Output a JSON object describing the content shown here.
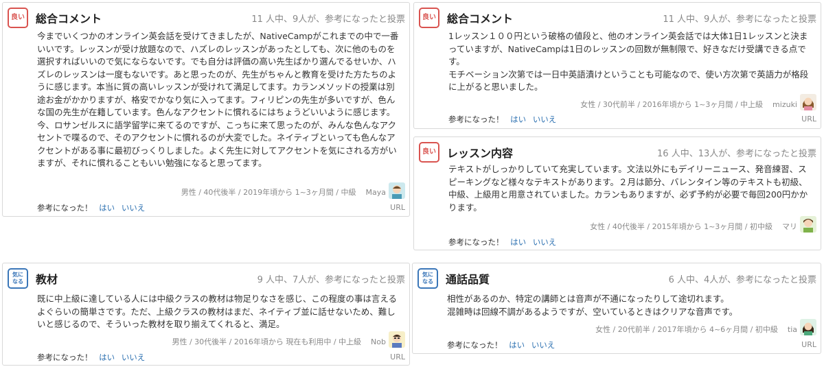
{
  "reviews": [
    {
      "badge_line1": "良い",
      "badge_line2": "",
      "title": "総合コメント",
      "votes": "11 人中、9人が、参考になったと投票",
      "body": [
        "今までいくつかのオンライン英会話を受けてきましたが、NativeCampがこれまでの中で一番いいです。レッスンが受け放題なので、ハズレのレッスンがあったとしても、次に他のものを選択すればいいので気にならないです。でも自分は評価の高い先生ばかり選んでるせいか、ハズレのレッスンは一度もないです。あと思ったのが、先生がちゃんと教育を受けた方たちのように感じます。本当に質の高いレッスンが受けれて満足してます。カランメソッドの授業は別途お金がかかりますが、格安でかなり気に入ってます。フィリピンの先生が多いですが、色んな国の先生が在籍しています。色んなアクセントに慣れるにはちょうどいいように感じます。今、ロサンゼルスに語学留学に来てるのですが、こっちに来て思ったのが、みんな色んなアクセントで喋るので、そのアクセントに慣れるのが大変でした。ネイティブといっても色んなアクセントがある事に最初びっくりしました。よく先生に対してアクセントを気にされる方がいますが、それに慣れることもいい勉強になると思ってます。"
      ],
      "meta": "男性 / 40代後半 / 2019年頃から 1~3ヶ月間 / 中級",
      "user": "Maya",
      "helpful_label": "参考になった！",
      "yes": "はい",
      "no": "いいえ",
      "url": "URL"
    },
    {
      "badge_line1": "良い",
      "badge_line2": "",
      "title": "総合コメント",
      "votes": "11 人中、9人が、参考になったと投票",
      "body": [
        "1レッスン１００円という破格の値段と、他のオンライン英会話では大体1日1レッスンと決まっていますが、NativeCampは1日のレッスンの回数が無制限で、好きなだけ受講できる点です。",
        "モチベーション次第では一日中英語漬けということも可能なので、使い方次第で英語力が格段に上がると思いました。"
      ],
      "meta": "女性 / 30代前半 / 2016年頃から 1~3ヶ月間 / 中上級",
      "user": "mizuki",
      "helpful_label": "参考になった！",
      "yes": "はい",
      "no": "いいえ",
      "url": "URL"
    },
    {
      "badge_line1": "良い",
      "badge_line2": "",
      "title": "レッスン内容",
      "votes": "16 人中、13人が、参考になったと投票",
      "body": [
        "テキストがしっかりしていて充実しています。文法以外にもデイリーニュース、発音練習、スピーキングなど様々なテキストがあります。２月は節分、バレンタイン等のテキストも初級、中級、上級用と用意されていました。カランもありますが、必ず予約が必要で毎回200円かかります。"
      ],
      "meta": "女性 / 40代後半 / 2015年頃から 1~3ヶ月間 / 初中級",
      "user": "マリ",
      "helpful_label": "参考になった！",
      "yes": "はい",
      "no": "いいえ",
      "url": "URL"
    },
    {
      "badge_line1": "気に",
      "badge_line2": "なる",
      "title": "教材",
      "votes": "9 人中、7人が、参考になったと投票",
      "body": [
        "既に中上級に達している人には中級クラスの教材は物足りなさを感じ、この程度の事は言えるよぐらいの簡単さです。ただ、上級クラスの教材はまだ、ネイティブ並に話せないため、難しいと感じるので、そういった教材を取り揃えてくれると、満足。"
      ],
      "meta": "男性 / 30代後半 / 2016年頃から 現在も利用中 / 中上級",
      "user": "Nob",
      "helpful_label": "参考になった！",
      "yes": "はい",
      "no": "いいえ",
      "url": "URL"
    },
    {
      "badge_line1": "気に",
      "badge_line2": "なる",
      "title": "通話品質",
      "votes": "6 人中、4人が、参考になったと投票",
      "body": [
        "相性があるのか、特定の講師とは音声が不通になったりして途切れます。",
        "混雑時は回線不調があるようですが、空いているときはクリアな音声です。"
      ],
      "meta": "女性 / 20代前半 / 2017年頃から 4~6ヶ月間 / 初中級",
      "user": "tia",
      "helpful_label": "参考になった！",
      "yes": "はい",
      "no": "いいえ",
      "url": "URL"
    }
  ],
  "colors": {
    "good_badge": "#d9534f",
    "care_badge": "#3a76b8",
    "link": "#2a6fb0"
  }
}
